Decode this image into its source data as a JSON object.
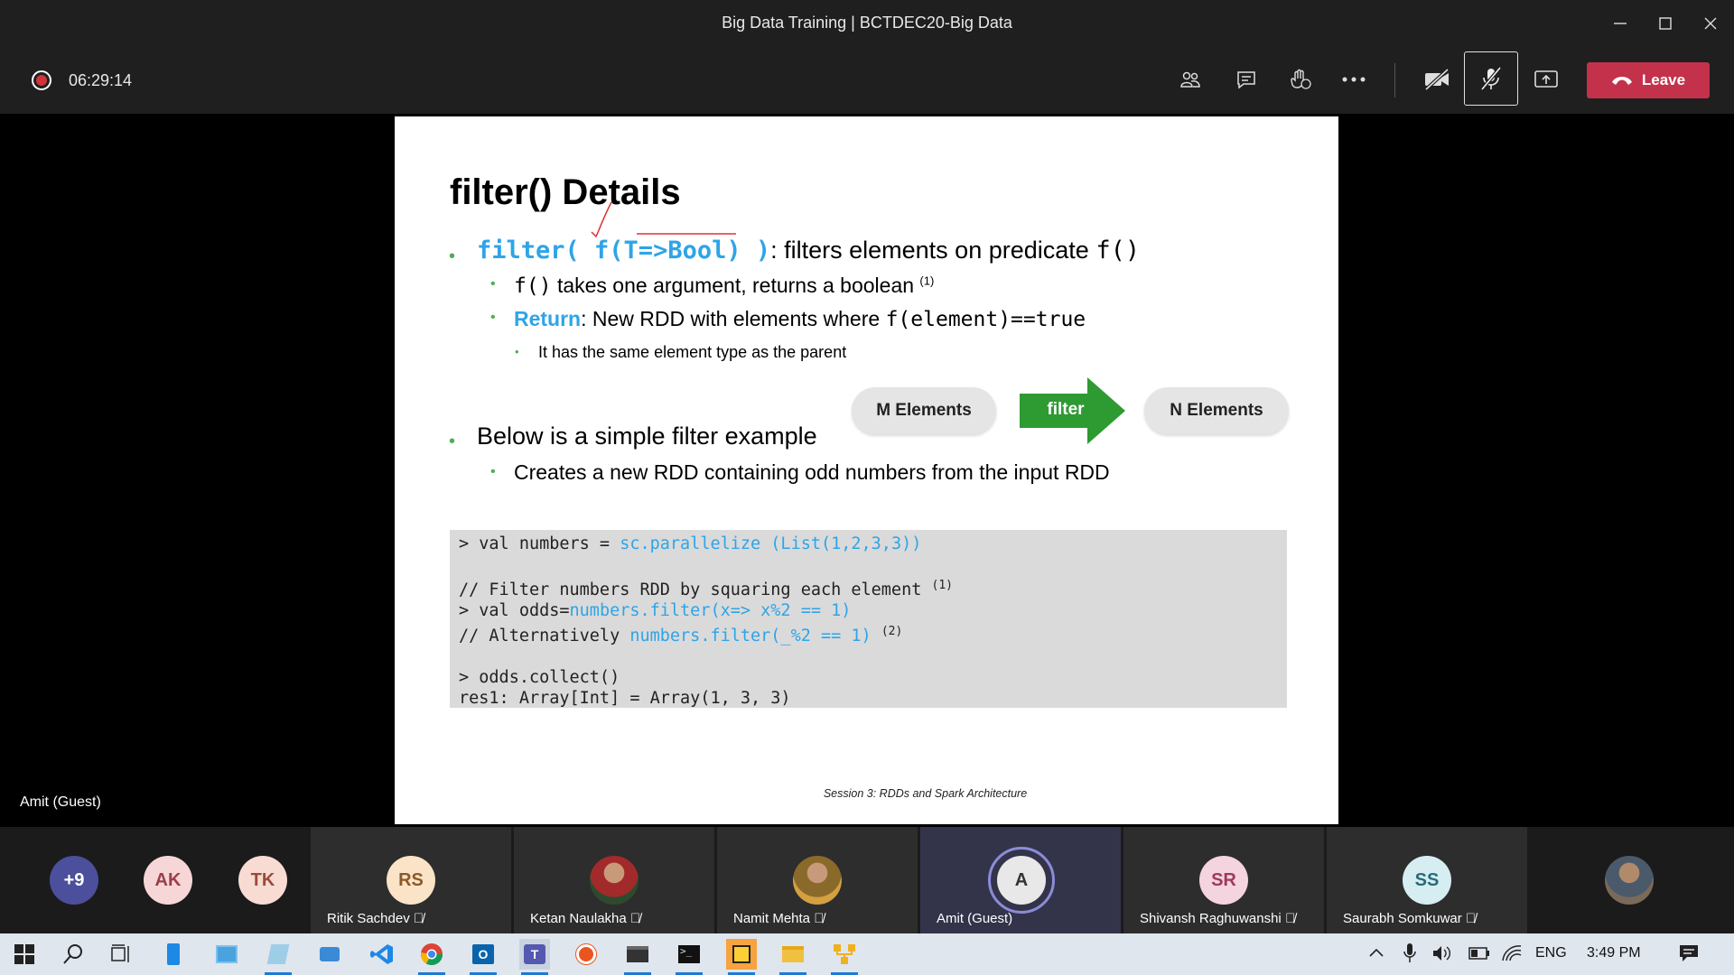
{
  "window": {
    "title": "Big Data Training | BCTDEC20-Big Data"
  },
  "meeting": {
    "recording_time": "06:29:14",
    "leave_label": "Leave",
    "stage_participant": "Amit (Guest)"
  },
  "slide": {
    "title": "filter() Details",
    "b1": {
      "code": "filter( f(T=>Bool) )",
      "text": ": filters elements on predicate",
      "fn": "f()"
    },
    "b1_1": {
      "fn": "f()",
      "text": " takes one argument, returns a boolean",
      "ref": "(1)"
    },
    "b1_2": {
      "label": "Return",
      "text": ": New RDD with elements where ",
      "code": "f(element)==true"
    },
    "b1_2_1": "It has the same element type as the parent",
    "b2": "Below is a simple filter example",
    "b2_1": "Creates a new RDD containing odd numbers from the input RDD",
    "diagram": {
      "left": "M Elements",
      "middle": "filter",
      "right": "N Elements"
    },
    "code": {
      "l1a": "> val numbers = ",
      "l1b": "sc.parallelize (List(1,2,3,3))",
      "l2": "// Filter numbers RDD by squaring each element",
      "l2ref": "(1)",
      "l3a": "> val odds=",
      "l3b": "numbers.filter(x=> x%2 == 1)",
      "l4a": "// Alternatively ",
      "l4b": "numbers.filter(_%2 == 1)",
      "l4ref": "(2)",
      "l5": "> odds.collect()",
      "l6": "res1: Array[Int] = Array(1, 3, 3)"
    },
    "footer": "Session 3: RDDs and Spark Architecture"
  },
  "participants": [
    {
      "initials": "+9",
      "name": "",
      "color": "#4b4f9c"
    },
    {
      "initials": "AK",
      "name": "",
      "color": "#f6d6d6"
    },
    {
      "initials": "TK",
      "name": "",
      "color": "#f8dcd4"
    },
    {
      "initials": "RS",
      "name": "Ritik Sachdev",
      "color": "#fbe3c8"
    },
    {
      "initials": "",
      "name": "Ketan Naulakha",
      "color": "#6a3b2f"
    },
    {
      "initials": "",
      "name": "Namit Mehta",
      "color": "#9a6a3a"
    },
    {
      "initials": "A",
      "name": "Amit (Guest)",
      "color": "#e8e8e8"
    },
    {
      "initials": "SR",
      "name": "Shivansh Raghuwanshi",
      "color": "#f4d4de"
    },
    {
      "initials": "SS",
      "name": "Saurabh Somkuwar",
      "color": "#d6eef2"
    },
    {
      "initials": "",
      "name": "",
      "color": "#5a6a7a"
    }
  ],
  "taskbar": {
    "language": "ENG",
    "clock": "3:49 PM"
  },
  "colors": {
    "accent": "#2fa4e7",
    "leave": "#c4314b",
    "bullet": "#4caf50",
    "filter_arrow": "#2e9a32"
  }
}
